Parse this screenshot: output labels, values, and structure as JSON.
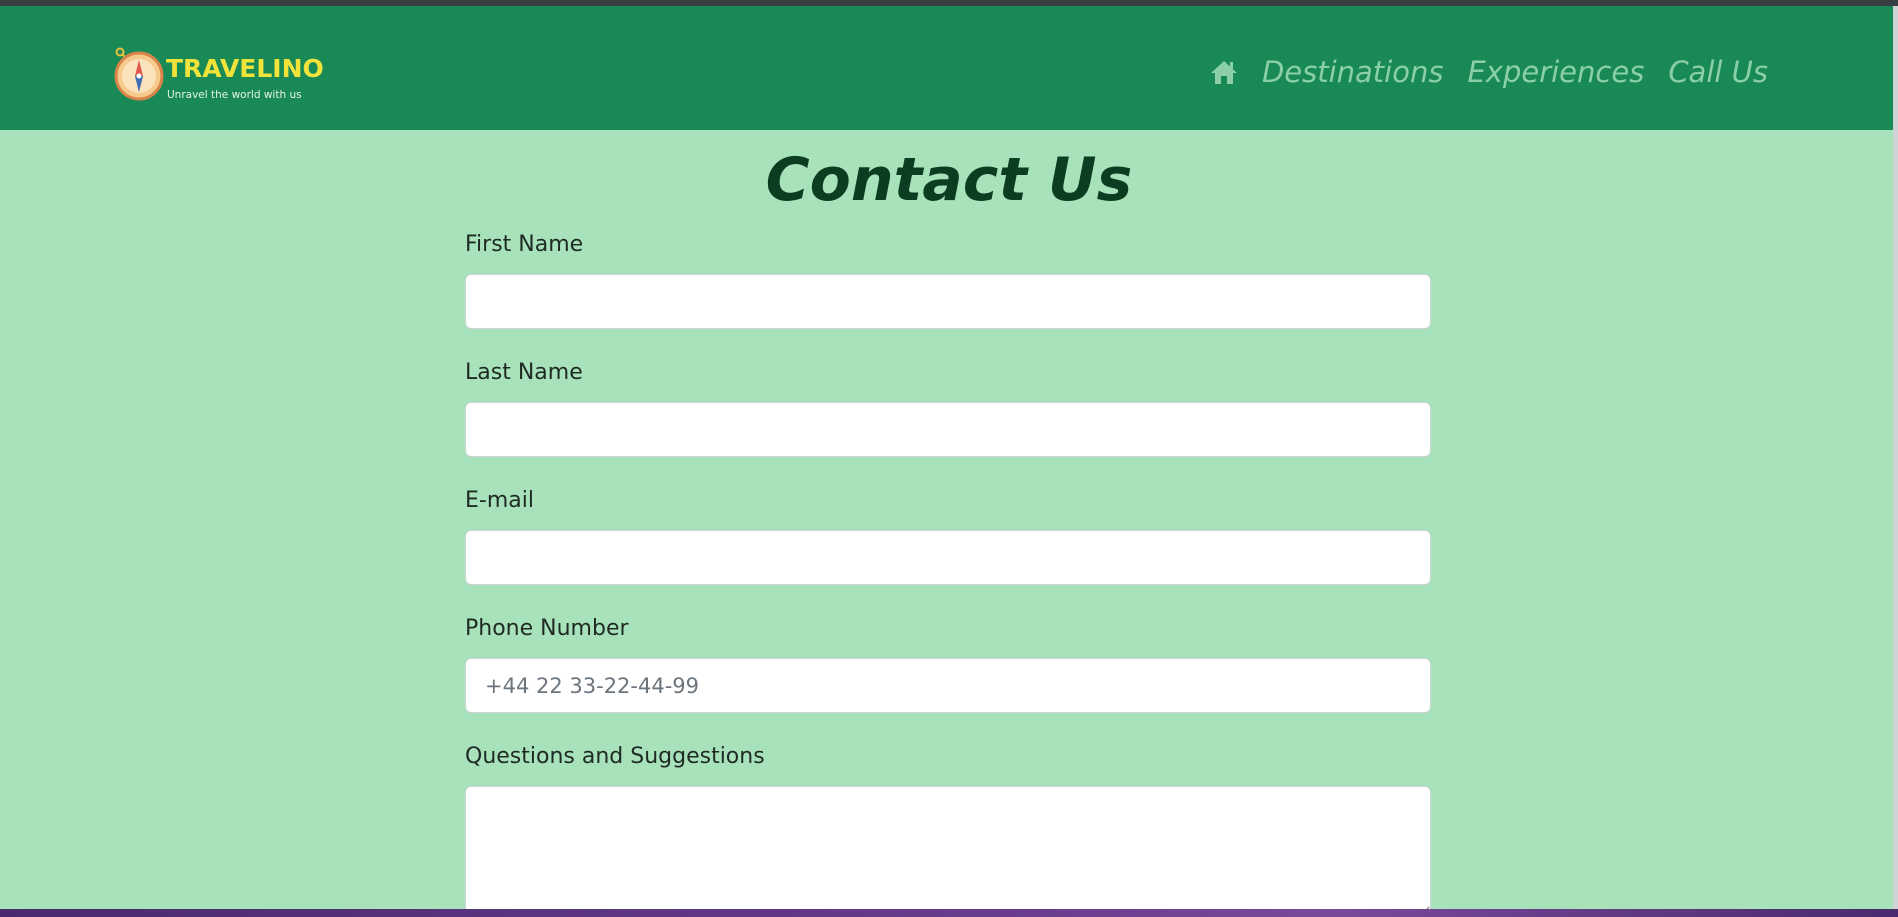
{
  "brand": {
    "name": "TRAVELINO",
    "tagline": "Unravel the world with us"
  },
  "nav": {
    "items": [
      {
        "label": "Destinations"
      },
      {
        "label": "Experiences"
      },
      {
        "label": "Call Us"
      }
    ],
    "home_icon": "home-icon"
  },
  "page": {
    "title": "Contact Us"
  },
  "form": {
    "first_name": {
      "label": "First Name",
      "value": "",
      "placeholder": ""
    },
    "last_name": {
      "label": "Last Name",
      "value": "",
      "placeholder": ""
    },
    "email": {
      "label": "E-mail",
      "value": "",
      "placeholder": ""
    },
    "phone": {
      "label": "Phone Number",
      "value": "",
      "placeholder": "+44 22 33-22-44-99"
    },
    "questions": {
      "label": "Questions and Suggestions",
      "value": "",
      "placeholder": ""
    }
  },
  "colors": {
    "navbar": "#198955",
    "background": "#a8e2ba",
    "title": "#0b3d21",
    "nav_link": "#8bcfa7",
    "brand_text": "#f2e33a"
  }
}
